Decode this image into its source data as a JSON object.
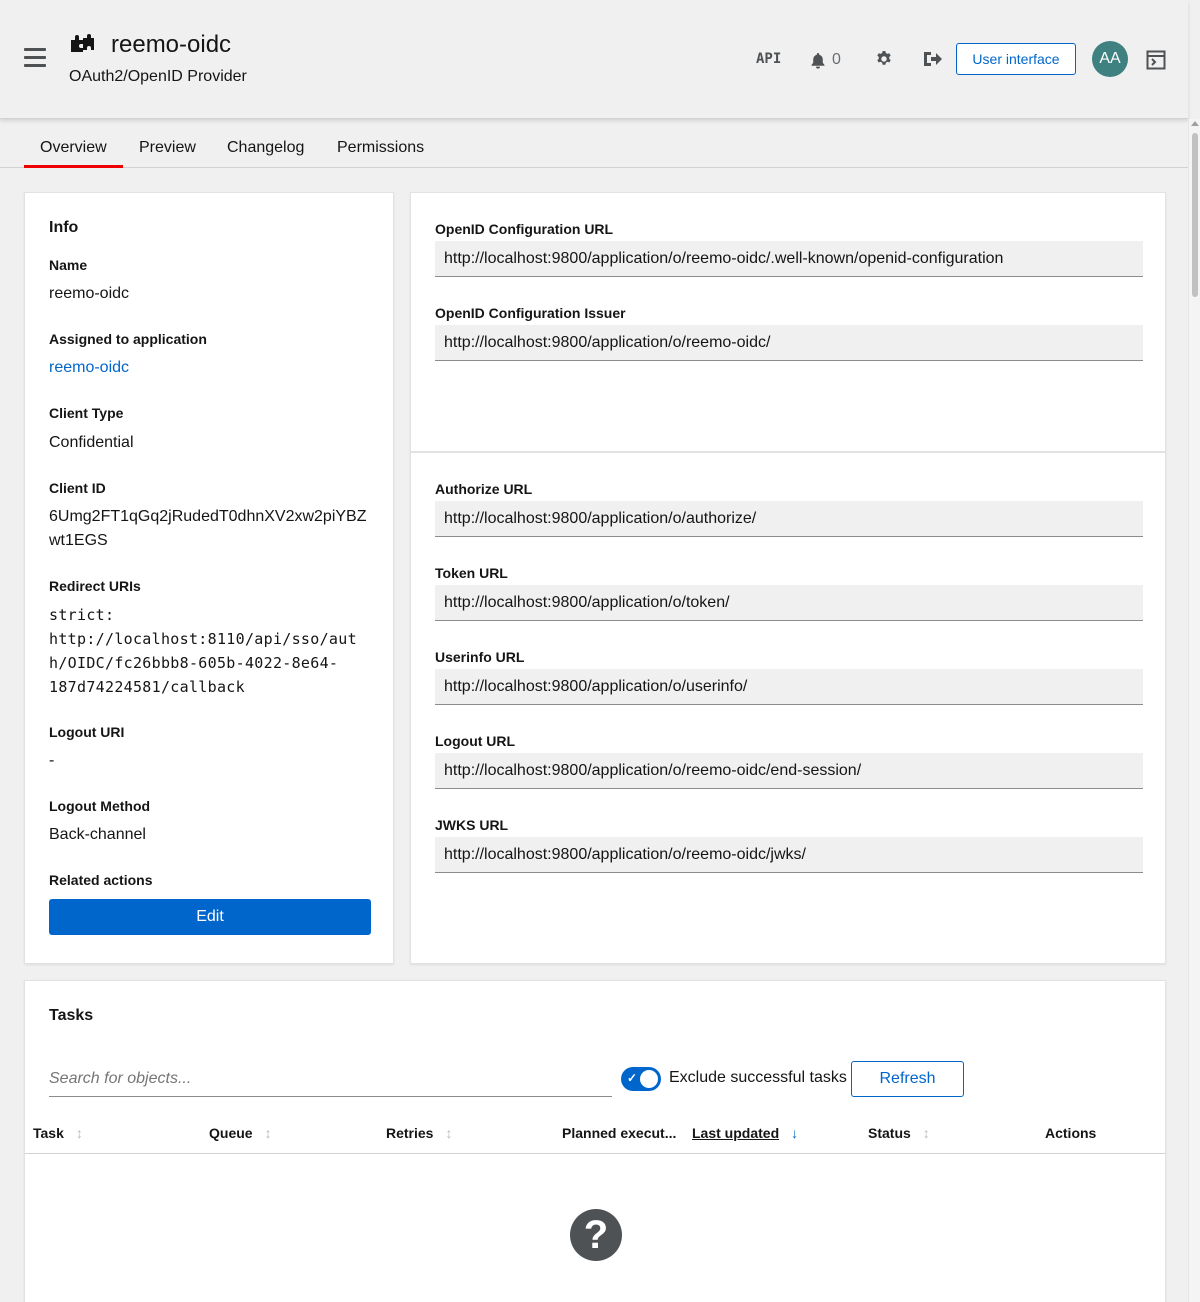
{
  "header": {
    "title": "reemo-oidc",
    "subtitle": "OAuth2/OpenID Provider",
    "api_label": "API",
    "notification_count": "0",
    "user_interface_label": "User interface",
    "avatar_initials": "AA",
    "icons": [
      "hamburger-icon",
      "puzzle-icon",
      "bell-icon",
      "gear-icon",
      "logout-icon",
      "console-icon"
    ]
  },
  "tabs": [
    {
      "label": "Overview",
      "active": true
    },
    {
      "label": "Preview",
      "active": false
    },
    {
      "label": "Changelog",
      "active": false
    },
    {
      "label": "Permissions",
      "active": false
    }
  ],
  "info": {
    "title": "Info",
    "name_label": "Name",
    "name_value": "reemo-oidc",
    "assigned_label": "Assigned to application",
    "assigned_value": "reemo-oidc",
    "client_type_label": "Client Type",
    "client_type_value": "Confidential",
    "client_id_label": "Client ID",
    "client_id_line1": "6Umg2FT1qGq2jRudedT0dhnXV2xw2piYBZ",
    "client_id_line2": "wt1EGS",
    "redirect_label": "Redirect URIs",
    "redirect_line1": "strict:",
    "redirect_line2": "http://localhost:8110/api/sso/aut",
    "redirect_line3": "h/OIDC/fc26bbb8-605b-4022-8e64-",
    "redirect_line4": "187d74224581/callback",
    "logout_uri_label": "Logout URI",
    "logout_uri_value": "-",
    "logout_method_label": "Logout Method",
    "logout_method_value": "Back-channel",
    "related_label": "Related actions",
    "edit_label": "Edit"
  },
  "urls": {
    "openid_config_url_label": "OpenID Configuration URL",
    "openid_config_url": "http://localhost:9800/application/o/reemo-oidc/.well-known/openid-configuration",
    "openid_issuer_label": "OpenID Configuration Issuer",
    "openid_issuer": "http://localhost:9800/application/o/reemo-oidc/",
    "authorize_label": "Authorize URL",
    "authorize_url": "http://localhost:9800/application/o/authorize/",
    "token_label": "Token URL",
    "token_url": "http://localhost:9800/application/o/token/",
    "userinfo_label": "Userinfo URL",
    "userinfo_url": "http://localhost:9800/application/o/userinfo/",
    "logout_label": "Logout URL",
    "logout_url": "http://localhost:9800/application/o/reemo-oidc/end-session/",
    "jwks_label": "JWKS URL",
    "jwks_url": "http://localhost:9800/application/o/reemo-oidc/jwks/"
  },
  "tasks": {
    "title": "Tasks",
    "search_placeholder": "Search for objects...",
    "exclude_label": "Exclude successful tasks",
    "exclude_checked": true,
    "refresh_label": "Refresh",
    "columns": [
      {
        "label": "Task",
        "sortable": true,
        "sorted": false
      },
      {
        "label": "Queue",
        "sortable": true,
        "sorted": false
      },
      {
        "label": "Retries",
        "sortable": true,
        "sorted": false
      },
      {
        "label": "Planned execut...",
        "sortable": false,
        "sorted": false
      },
      {
        "label": "Last updated",
        "sortable": true,
        "sorted": true
      },
      {
        "label": "Status",
        "sortable": true,
        "sorted": false
      },
      {
        "label": "Actions",
        "sortable": false,
        "sorted": false
      }
    ],
    "empty_icon": "question-circle-icon"
  },
  "colors": {
    "accent": "#0066cc",
    "active_tab": "#ee0000",
    "avatar_bg": "#3f8080"
  }
}
